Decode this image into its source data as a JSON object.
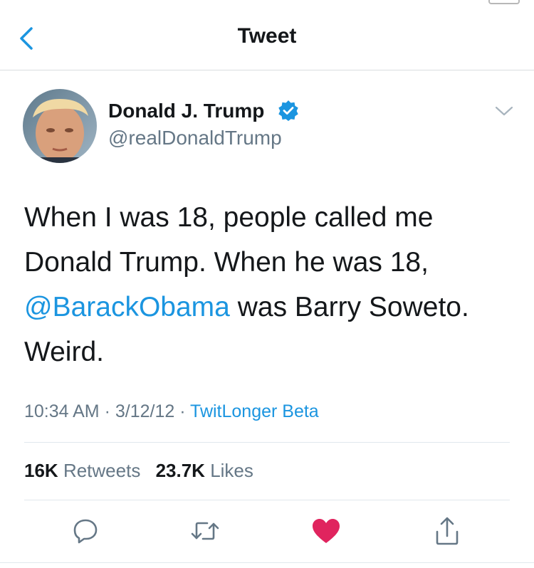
{
  "header": {
    "title": "Tweet",
    "back_icon": "chevron-left-icon"
  },
  "author": {
    "name": "Donald J. Trump",
    "handle": "@realDonaldTrump",
    "verified_icon": "verified-badge-icon"
  },
  "tweet": {
    "text_before": "When I was 18, people called me Donald Trump. When he was 18, ",
    "mention": "@BarackObama",
    "text_after": " was Barry Soweto. Weird."
  },
  "meta": {
    "time": "10:34 AM",
    "sep1": " · ",
    "date": "3/12/12",
    "sep2": " · ",
    "source": "TwitLonger Beta"
  },
  "stats": {
    "retweets_count": "16K",
    "retweets_label": "Retweets",
    "likes_count": "23.7K",
    "likes_label": "Likes"
  },
  "actions": [
    {
      "icon": "reply-icon"
    },
    {
      "icon": "retweet-icon"
    },
    {
      "icon": "heart-icon",
      "active": true,
      "color": "#e0245e"
    },
    {
      "icon": "share-icon"
    }
  ],
  "colors": {
    "link": "#1b95e0",
    "muted": "#657786",
    "like": "#e0245e"
  }
}
